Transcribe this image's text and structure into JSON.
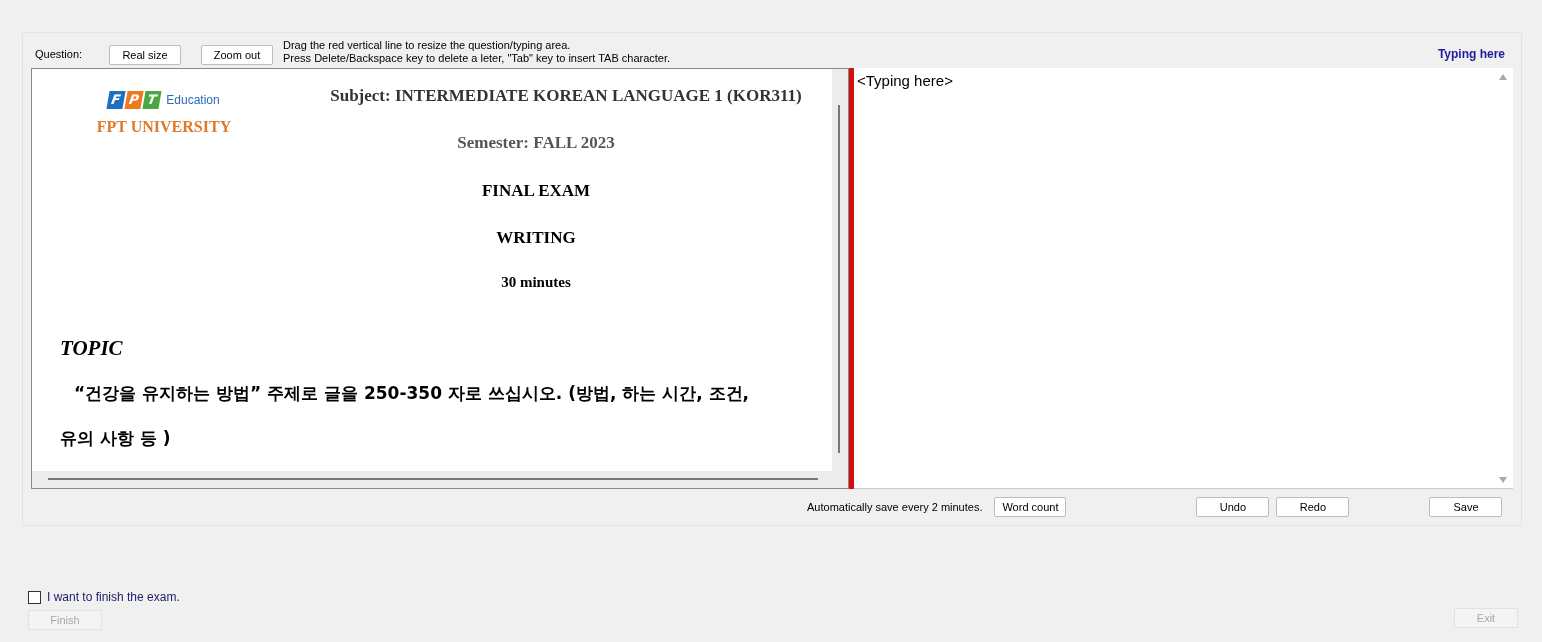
{
  "toolbar": {
    "question_label": "Question:",
    "buttons": [
      "Real size",
      "Zoom out"
    ],
    "hints": [
      "Drag the red vertical line to resize the question/typing area.",
      "Press Delete/Backspace key to delete a leter, \"Tab\" key to insert TAB character."
    ],
    "typing_label": "Typing here"
  },
  "question_document": {
    "logo": {
      "letters": [
        {
          "char": "F",
          "color": "#1f6fc0"
        },
        {
          "char": "P",
          "color": "#ee7a1d"
        },
        {
          "char": "T",
          "color": "#4aa842"
        }
      ],
      "tagline": "Education",
      "name": "FPT UNIVERSITY"
    },
    "subject": "Subject: **INTERMEDIATE KOREAN LANGUAGE 1 (KOR311)**",
    "semester": "Semester: **FALL 2023**",
    "lines": [
      "FINAL EXAM",
      "WRITING",
      "30 minutes"
    ],
    "topic_heading": "TOPIC",
    "topic_text": [
      "“건강을 유지하는 방법” 주제로 글을 250-350 자로 쓰십시오. (방법, 하는 시간, 조건,",
      "유의 사항 등 )"
    ]
  },
  "answer": {
    "value": "<Typing here>"
  },
  "footer": {
    "autosave_note": "Automatically save every 2 minutes.",
    "word_count_button": "Word count",
    "edit_buttons": [
      "Undo",
      "Redo"
    ],
    "save_button": "Save"
  },
  "finish": {
    "checkbox_label": "I want to finish the exam.",
    "checked": false,
    "button": {
      "label": "Finish",
      "disabled": true
    }
  },
  "exit_button": {
    "label": "Exit",
    "disabled": true
  }
}
